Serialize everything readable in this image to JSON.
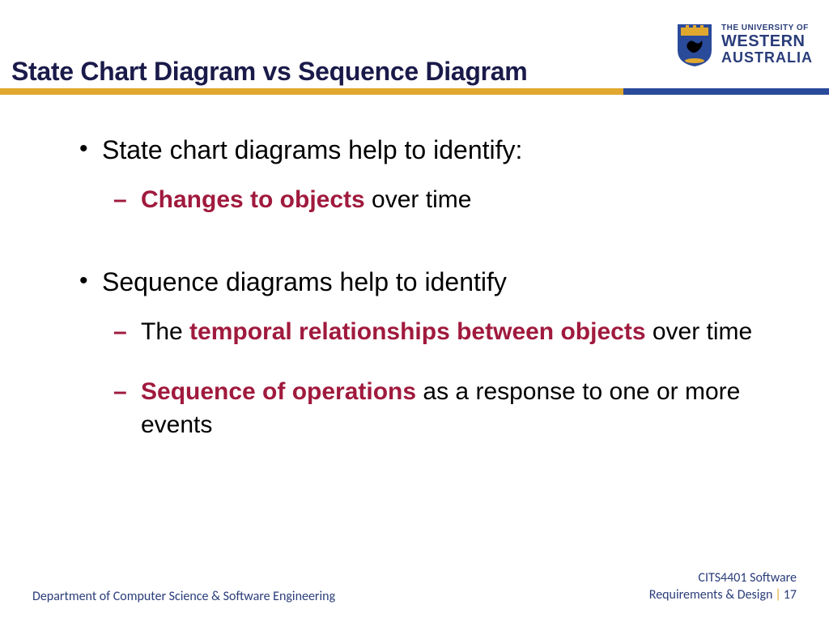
{
  "title": "State Chart Diagram vs Sequence Diagram",
  "logo": {
    "line1": "THE UNIVERSITY OF",
    "line2": "WESTERN",
    "line3": "AUSTRALIA"
  },
  "bullet1": {
    "text": "State chart diagrams help to identify:",
    "sub1_hl": "Changes to objects",
    "sub1_rest": " over time"
  },
  "bullet2": {
    "text": "Sequence diagrams help to identify",
    "sub1_pre": "The ",
    "sub1_hl": "temporal relationships between objects",
    "sub1_rest": " over time",
    "sub2_hl": "Sequence of operations",
    "sub2_rest": " as a response to one or more events"
  },
  "footer": {
    "left": "Department of Computer Science & Software Engineering",
    "right1": "CITS4401 Software",
    "right2a": "Requirements & Design",
    "right2b": "17"
  }
}
